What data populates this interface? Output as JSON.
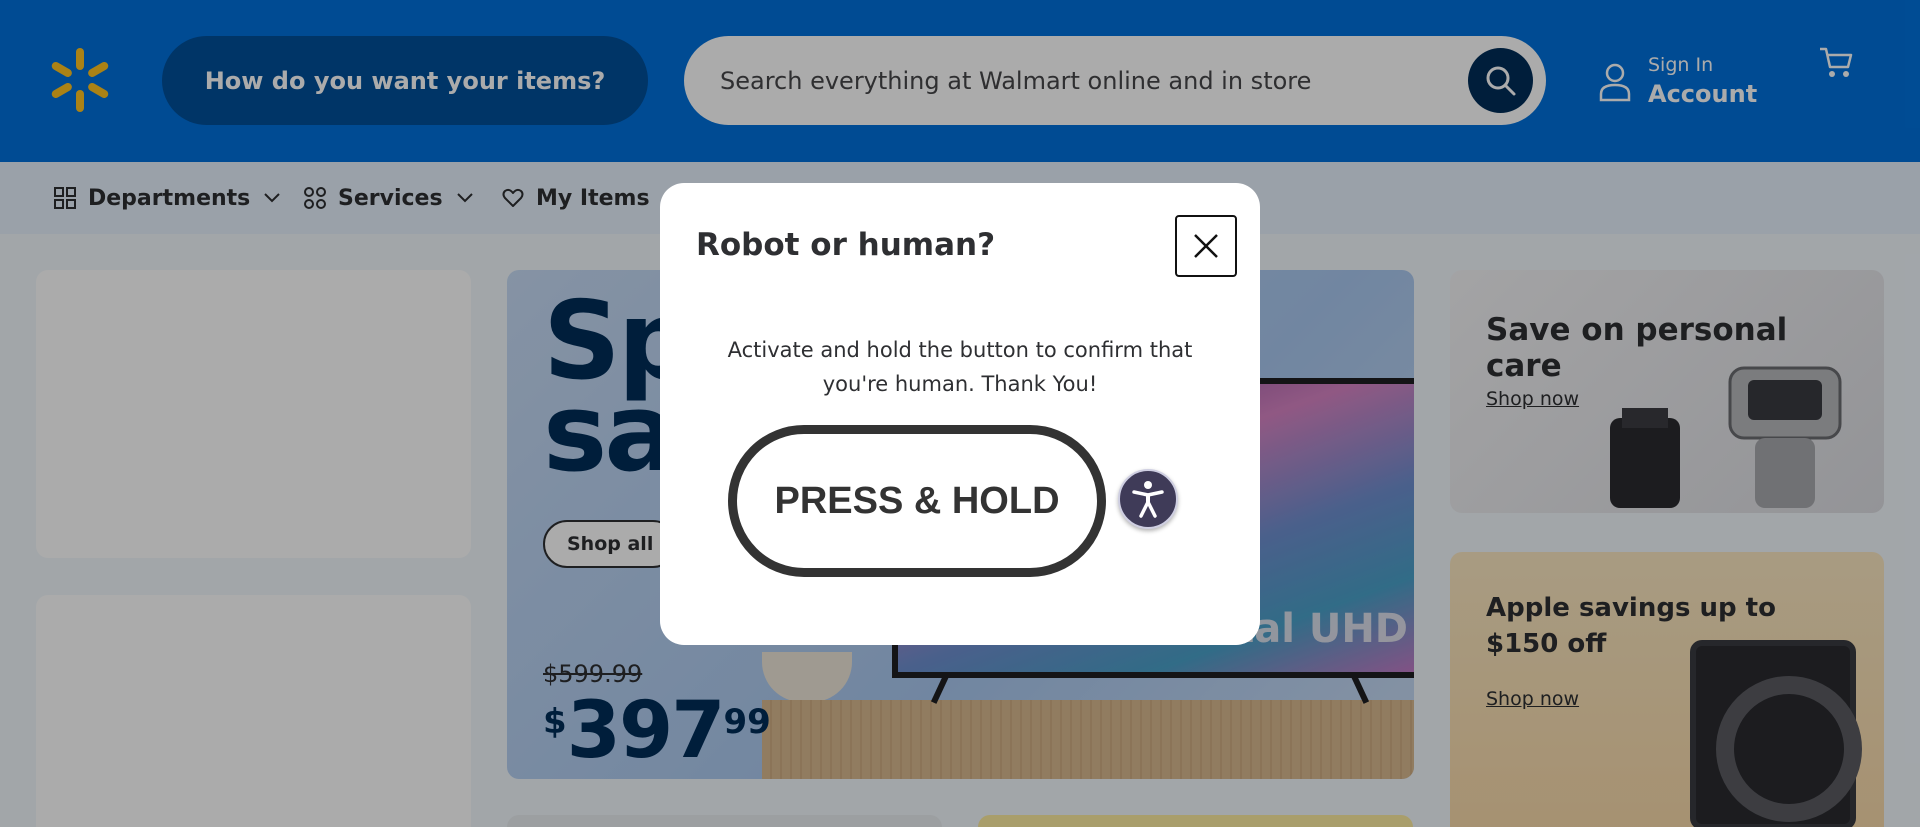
{
  "header": {
    "fulfillment_label": "How do you want your items?",
    "search_placeholder": "Search everything at Walmart online and in store",
    "account_small": "Sign In",
    "account_big": "Account"
  },
  "nav": {
    "items": [
      {
        "label": "Departments",
        "icon": "grid-icon"
      },
      {
        "label": "Services",
        "icon": "services-icon"
      },
      {
        "label": "My Items",
        "icon": "heart-icon"
      }
    ]
  },
  "hero": {
    "title_line1": "Sp",
    "title_line2": "sa",
    "cta": "Shop all",
    "old_price": "$599.99",
    "price_currency": "$",
    "price_dollars": "397",
    "price_cents": "99",
    "tv_text": "stal UHD"
  },
  "promos": [
    {
      "title": "Save on personal care",
      "cta": "Shop now"
    },
    {
      "title": "Apple savings up to $150 off",
      "cta": "Shop now"
    }
  ],
  "modal": {
    "title": "Robot or human?",
    "message": "Activate and hold the button to confirm that you're human. Thank You!",
    "hold_button": "PRESS & HOLD"
  },
  "colors": {
    "brand_blue": "#0071dc",
    "spark_yellow": "#ffc220",
    "dark_blue": "#002d58"
  }
}
